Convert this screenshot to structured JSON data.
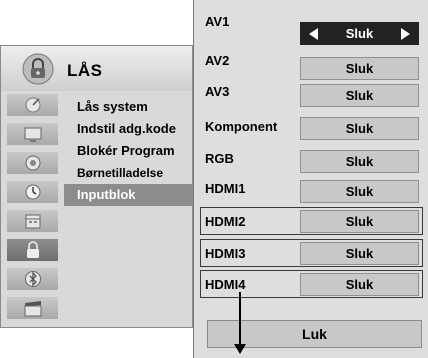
{
  "lock_menu": {
    "title": "LÅS",
    "header_icon": "padlock-icon",
    "side_icons": [
      "satellite-dish-icon",
      "tv-screen-icon",
      "speaker-icon",
      "clock-icon",
      "calendar-icon",
      "padlock-icon",
      "bluetooth-icon",
      "clapperboard-icon"
    ],
    "active_side_icon": "padlock-icon",
    "items": [
      {
        "label": "Lås system"
      },
      {
        "label": "Indstil adg.kode"
      },
      {
        "label": "Blokér Program"
      },
      {
        "label": "Børnetilladelse"
      },
      {
        "label": "Inputblok"
      }
    ],
    "selected_item": "Inputblok"
  },
  "input_block": {
    "rows": [
      {
        "label": "AV1",
        "value": "Sluk",
        "active": true,
        "boxed": false
      },
      {
        "label": "AV2",
        "value": "Sluk",
        "active": false,
        "boxed": false
      },
      {
        "label": "AV3",
        "value": "Sluk",
        "active": false,
        "boxed": false
      },
      {
        "label": "Komponent",
        "value": "Sluk",
        "active": false,
        "boxed": false
      },
      {
        "label": "RGB",
        "value": "Sluk",
        "active": false,
        "boxed": false
      },
      {
        "label": "HDMI1",
        "value": "Sluk",
        "active": false,
        "boxed": false
      },
      {
        "label": "HDMI2",
        "value": "Sluk",
        "active": false,
        "boxed": true
      },
      {
        "label": "HDMI3",
        "value": "Sluk",
        "active": false,
        "boxed": true
      },
      {
        "label": "HDMI4",
        "value": "Sluk",
        "active": false,
        "boxed": true
      }
    ],
    "close_label": "Luk"
  },
  "colors": {
    "active_value_bg": "#222222",
    "selected_menu_bg": "#8c8c8c",
    "panel_bg": "#dedede"
  }
}
